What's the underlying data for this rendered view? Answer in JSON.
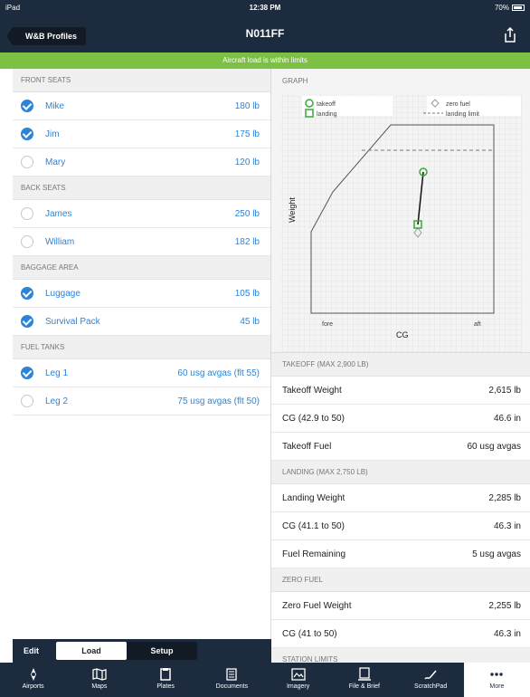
{
  "status": {
    "device": "iPad",
    "time": "12:38 PM",
    "battery": "70%"
  },
  "nav": {
    "back_label": "W&B Profiles",
    "title": "N011FF"
  },
  "banner": "Aircraft load is within limits",
  "left": {
    "sections": [
      {
        "title": "FRONT SEATS",
        "rows": [
          {
            "name": "Mike",
            "value": "180 lb",
            "checked": true
          },
          {
            "name": "Jim",
            "value": "175 lb",
            "checked": true
          },
          {
            "name": "Mary",
            "value": "120 lb",
            "checked": false
          }
        ]
      },
      {
        "title": "BACK SEATS",
        "rows": [
          {
            "name": "James",
            "value": "250 lb",
            "checked": false
          },
          {
            "name": "William",
            "value": "182 lb",
            "checked": false
          }
        ]
      },
      {
        "title": "BAGGAGE AREA",
        "rows": [
          {
            "name": "Luggage",
            "value": "105 lb",
            "checked": true
          },
          {
            "name": "Survival Pack",
            "value": "45 lb",
            "checked": true
          }
        ]
      },
      {
        "title": "FUEL TANKS",
        "rows": [
          {
            "name": "Leg 1",
            "value": "60 usg avgas (flt 55)",
            "checked": true
          },
          {
            "name": "Leg 2",
            "value": "75 usg avgas (flt 50)",
            "checked": false
          }
        ]
      }
    ],
    "tabs": {
      "edit": "Edit",
      "load": "Load",
      "setup": "Setup"
    }
  },
  "graph": {
    "header": "GRAPH",
    "legend": {
      "takeoff": "takeoff",
      "landing": "landing",
      "zero_fuel": "zero fuel",
      "landing_limit": "landing limit"
    },
    "axis_y": "Weight",
    "axis_x": "CG",
    "x_fore": "fore",
    "x_aft": "aft"
  },
  "right": {
    "takeoff_header": "TAKEOFF (MAX 2,900 LB)",
    "takeoff_rows": [
      {
        "label": "Takeoff Weight",
        "value": "2,615 lb"
      },
      {
        "label": "CG (42.9 to 50)",
        "value": "46.6 in"
      },
      {
        "label": "Takeoff Fuel",
        "value": "60 usg avgas"
      }
    ],
    "landing_header": "LANDING (MAX 2,750 LB)",
    "landing_rows": [
      {
        "label": "Landing Weight",
        "value": "2,285 lb"
      },
      {
        "label": "CG (41.1 to 50)",
        "value": "46.3 in"
      },
      {
        "label": "Fuel Remaining",
        "value": "5 usg avgas"
      }
    ],
    "zero_header": "ZERO FUEL",
    "zero_rows": [
      {
        "label": "Zero Fuel Weight",
        "value": "2,255 lb"
      },
      {
        "label": "CG (41 to 50)",
        "value": "46.3 in"
      }
    ],
    "station_header": "STATION LIMITS"
  },
  "tabbar": [
    {
      "label": "Airports",
      "icon": "airport-icon"
    },
    {
      "label": "Maps",
      "icon": "map-icon"
    },
    {
      "label": "Plates",
      "icon": "plates-icon"
    },
    {
      "label": "Documents",
      "icon": "documents-icon"
    },
    {
      "label": "Imagery",
      "icon": "imagery-icon"
    },
    {
      "label": "File & Brief",
      "icon": "file-brief-icon"
    },
    {
      "label": "ScratchPad",
      "icon": "scratchpad-icon"
    },
    {
      "label": "More",
      "icon": "more-icon",
      "active": true
    }
  ],
  "colors": {
    "nav": "#1c2b3d",
    "banner": "#7cc143",
    "accent": "#2c84d8",
    "graph_green": "#3aa83a"
  }
}
